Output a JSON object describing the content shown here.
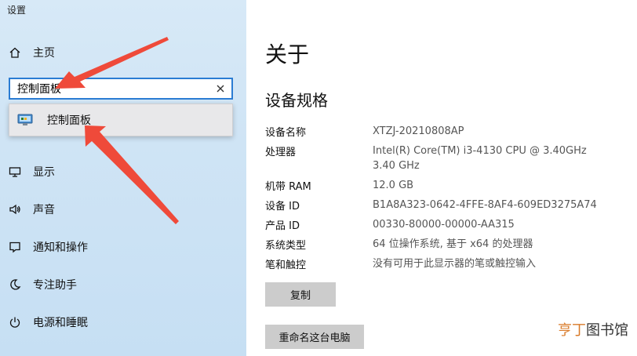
{
  "app": {
    "title": "设置"
  },
  "sidebar": {
    "home": {
      "label": "主页",
      "icon": "home-icon"
    },
    "search": {
      "value": "控制面板",
      "clear_icon": "close-icon"
    },
    "suggestion": {
      "label": "控制面板",
      "icon": "control-panel-icon"
    },
    "items": [
      {
        "label": "显示",
        "icon": "monitor-icon"
      },
      {
        "label": "声音",
        "icon": "speaker-icon"
      },
      {
        "label": "通知和操作",
        "icon": "notification-icon"
      },
      {
        "label": "专注助手",
        "icon": "moon-icon"
      },
      {
        "label": "电源和睡眠",
        "icon": "power-icon"
      }
    ]
  },
  "main": {
    "title": "关于",
    "section": "设备规格",
    "specs": [
      {
        "label": "设备名称",
        "value": "XTZJ-20210808AP"
      },
      {
        "label": "处理器",
        "value": "Intel(R) Core(TM) i3-4130 CPU @ 3.40GHz   3.40 GHz"
      },
      {
        "label": "机带 RAM",
        "value": "12.0 GB"
      },
      {
        "label": "设备 ID",
        "value": "B1A8A323-0642-4FFE-8AF4-609ED3275A74"
      },
      {
        "label": "产品 ID",
        "value": "00330-80000-00000-AA315"
      },
      {
        "label": "系统类型",
        "value": "64 位操作系统, 基于 x64 的处理器"
      },
      {
        "label": "笔和触控",
        "value": "没有可用于此显示器的笔或触控输入"
      }
    ],
    "copy_button": "复制",
    "rename_button": "重命名这台电脑"
  },
  "watermark": {
    "part1": "亨丁",
    "part2": "图书馆"
  },
  "colors": {
    "accent": "#2b7cd3",
    "arrow": "#ef4a3a",
    "sidebar_bg": "#cfe4f5"
  }
}
